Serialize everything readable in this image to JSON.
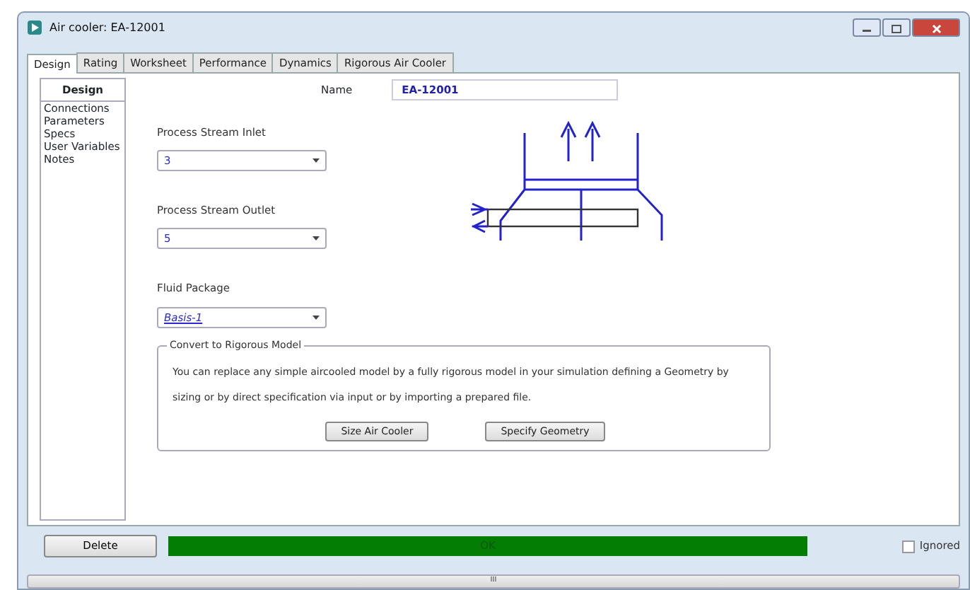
{
  "window": {
    "title": "Air cooler: EA-12001"
  },
  "tabs": [
    {
      "label": "Design",
      "selected": true
    },
    {
      "label": "Rating",
      "selected": false
    },
    {
      "label": "Worksheet",
      "selected": false
    },
    {
      "label": "Performance",
      "selected": false
    },
    {
      "label": "Dynamics",
      "selected": false
    },
    {
      "label": "Rigorous Air Cooler",
      "selected": false
    }
  ],
  "sidebar": {
    "title": "Design",
    "items": [
      "Connections",
      "Parameters",
      "Specs",
      "User Variables",
      "Notes"
    ]
  },
  "name_field": {
    "label": "Name",
    "value": "EA-12001"
  },
  "fields": [
    {
      "label": "Process Stream Inlet",
      "value": "3",
      "link": false
    },
    {
      "label": "Process Stream Outlet",
      "value": "5",
      "link": false
    },
    {
      "label": "Fluid Package",
      "value": "Basis-1",
      "link": true
    }
  ],
  "rigorous": {
    "title": "Convert to Rigorous Model",
    "text": "You can replace any simple aircooled model by a fully rigorous model in your simulation defining a Geometry by sizing or by direct specification via input or by importing a prepared file.",
    "buttons": [
      "Size Air Cooler",
      "Specify Geometry"
    ]
  },
  "footer": {
    "delete_button": "Delete",
    "status": "OK",
    "ignored": {
      "label": "Ignored",
      "checked": false
    }
  },
  "scrollbar": {
    "grip": "III"
  }
}
